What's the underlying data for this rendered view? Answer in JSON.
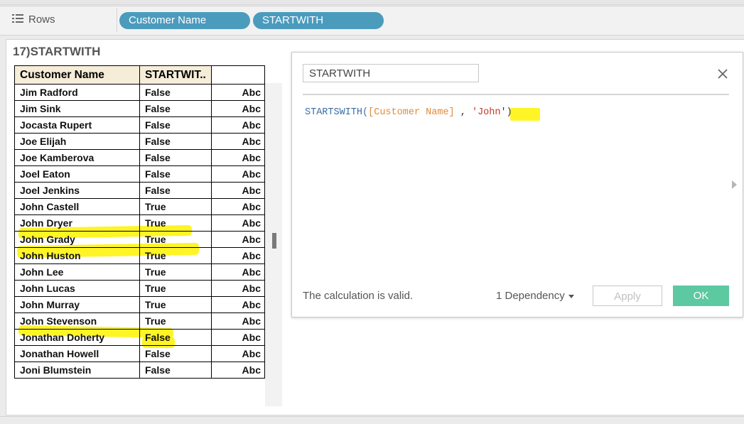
{
  "shelf": {
    "label": "Rows",
    "pills": [
      "Customer Name",
      "STARTWITH"
    ]
  },
  "sheet": {
    "title": "17)STARTWITH",
    "columns": [
      "Customer Name",
      "STARTWIT..",
      ""
    ],
    "rows": [
      {
        "name": "Jim Radford",
        "value": "False",
        "marker": "Abc"
      },
      {
        "name": "Jim Sink",
        "value": "False",
        "marker": "Abc"
      },
      {
        "name": "Jocasta Rupert",
        "value": "False",
        "marker": "Abc"
      },
      {
        "name": "Joe Elijah",
        "value": "False",
        "marker": "Abc"
      },
      {
        "name": "Joe Kamberova",
        "value": "False",
        "marker": "Abc"
      },
      {
        "name": "Joel Eaton",
        "value": "False",
        "marker": "Abc"
      },
      {
        "name": "Joel Jenkins",
        "value": "False",
        "marker": "Abc"
      },
      {
        "name": "John Castell",
        "value": "True",
        "marker": "Abc"
      },
      {
        "name": "John Dryer",
        "value": "True",
        "marker": "Abc"
      },
      {
        "name": "John Grady",
        "value": "True",
        "marker": "Abc"
      },
      {
        "name": "John Huston",
        "value": "True",
        "marker": "Abc"
      },
      {
        "name": "John Lee",
        "value": "True",
        "marker": "Abc"
      },
      {
        "name": "John Lucas",
        "value": "True",
        "marker": "Abc"
      },
      {
        "name": "John Murray",
        "value": "True",
        "marker": "Abc"
      },
      {
        "name": "John Stevenson",
        "value": "True",
        "marker": "Abc"
      },
      {
        "name": "Jonathan Doherty",
        "value": "False",
        "marker": "Abc"
      },
      {
        "name": "Jonathan Howell",
        "value": "False",
        "marker": "Abc"
      },
      {
        "name": "Joni Blumstein",
        "value": "False",
        "marker": "Abc"
      }
    ]
  },
  "dialog": {
    "calc_name": "STARTWITH",
    "formula": {
      "func": "STARTSWITH(",
      "field": "[Customer Name]",
      "sep": " , ",
      "quote_open": "'",
      "string": "John",
      "close": "')"
    },
    "status": "The calculation is valid.",
    "dependency": "1 Dependency",
    "apply": "Apply",
    "ok": "OK"
  },
  "colors": {
    "pill": "#4b9bbd",
    "header": "#f6edd8",
    "highlight": "#fff200",
    "ok_button": "#5cc9a0"
  }
}
